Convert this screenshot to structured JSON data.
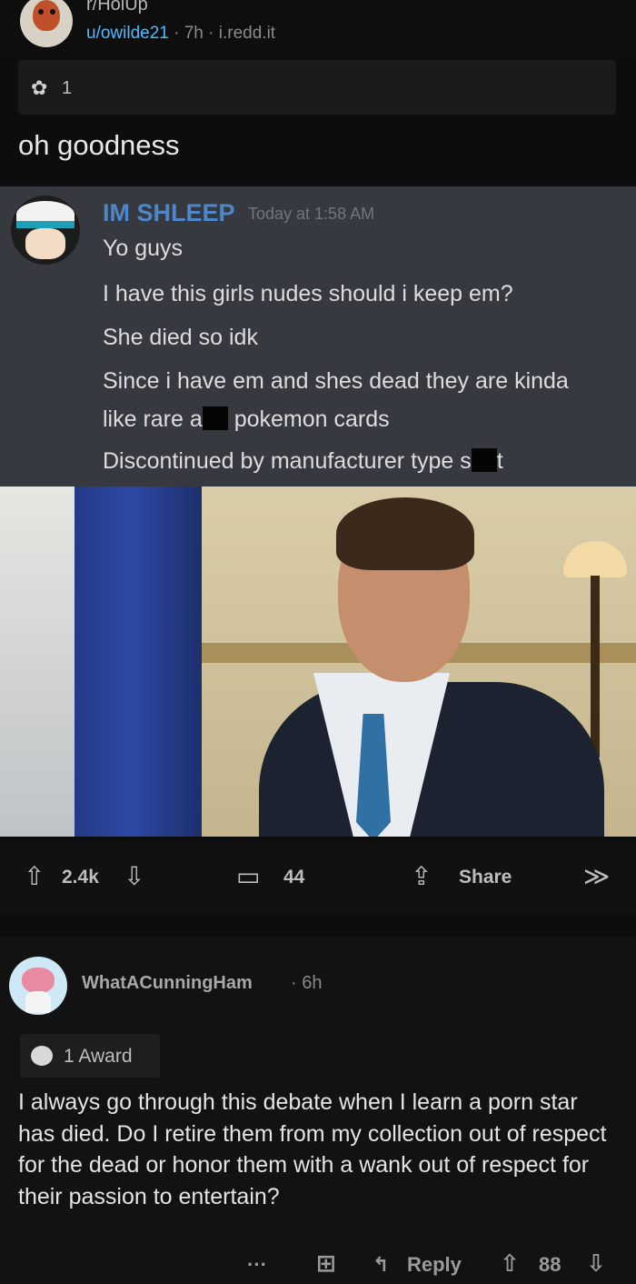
{
  "post": {
    "subreddit": "r/HolUp",
    "author": "u/owilde21",
    "age": "7h",
    "domain": "i.redd.it",
    "meta_sep": "·",
    "award_count": "1",
    "title": "oh goodness"
  },
  "image": {
    "discord_user": "IM SHLEEP",
    "discord_time": "Today at 1:58 AM",
    "lines": [
      "Yo guys",
      "I have this girls nudes should i keep em?",
      "She died so idk",
      "Since i have em and shes dead they are kinda",
      "like rare a",
      "pokemon cards",
      "Discontinued by manufacturer type s",
      "t"
    ]
  },
  "actions": {
    "upvote_icon": "arrow-up-icon",
    "votes": "2.4k",
    "comments": "44",
    "share": "Share",
    "up_glyph": "⇧",
    "down_glyph": "⇩",
    "comment_glyph": "▭",
    "share_glyph": "⇪",
    "collapse_glyph": "≫"
  },
  "comment": {
    "author": "WhatACunningHam",
    "age": "· 6h",
    "award_label": "1 Award",
    "body": "I always go through this debate when I learn a porn star has died. Do I retire them from my collection out of respect for the dead or honor them with a wank out of respect for their passion to entertain?",
    "more_glyph": "···",
    "gift_glyph": "⊞",
    "reply_glyph": "↰",
    "reply": "Reply",
    "score": "88"
  }
}
